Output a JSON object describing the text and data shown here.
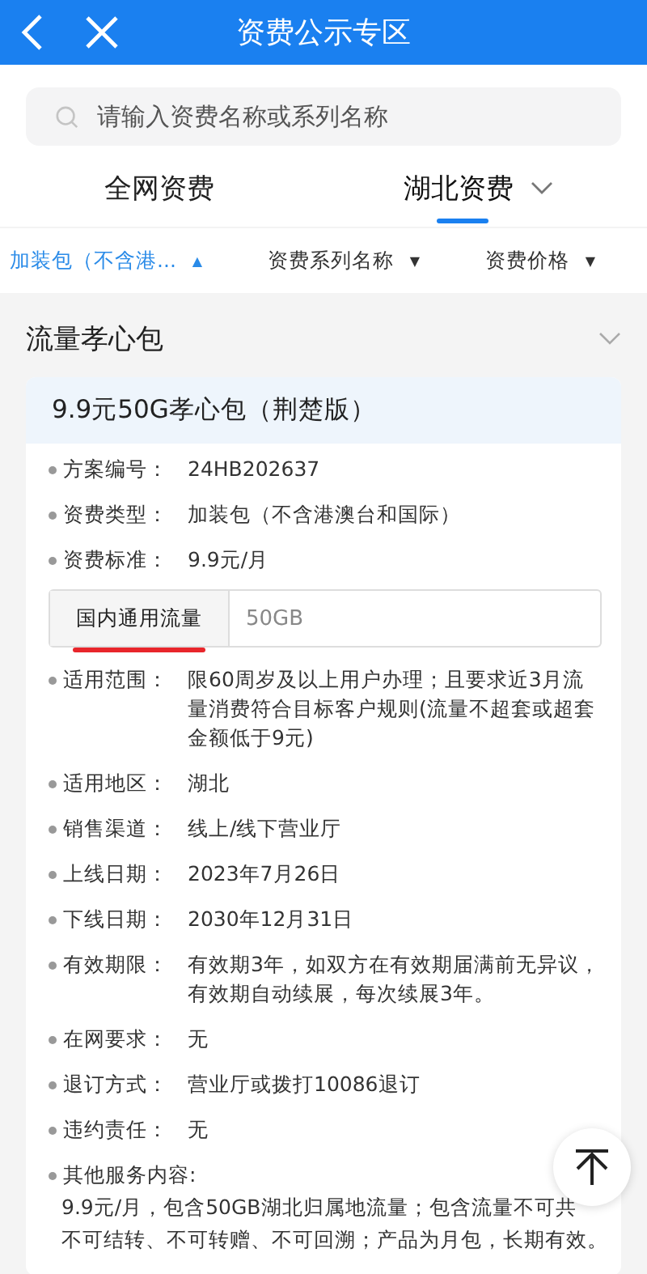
{
  "header": {
    "title": "资费公示专区"
  },
  "search": {
    "placeholder": "请输入资费名称或系列名称"
  },
  "tabs": [
    {
      "label": "全网资费",
      "selected": false,
      "dropdown": false
    },
    {
      "label": "湖北资费",
      "selected": true,
      "dropdown": true
    }
  ],
  "filters": [
    {
      "label": "加装包（不含港...",
      "selected": true,
      "icon": "▲"
    },
    {
      "label": "资费系列名称",
      "selected": false,
      "icon": "▼"
    },
    {
      "label": "资费价格",
      "selected": false,
      "icon": "▼"
    }
  ],
  "section": {
    "title": "流量孝心包",
    "expanded": true
  },
  "card": {
    "title": "9.9元50G孝心包（荆楚版）",
    "rows": [
      {
        "kind": "field",
        "label": "方案编号：",
        "value": "24HB202637"
      },
      {
        "kind": "field",
        "label": "资费类型：",
        "value": "加装包（不含港澳台和国际）"
      },
      {
        "kind": "field",
        "label": "资费标准：",
        "value": "9.9元/月"
      },
      {
        "kind": "spec",
        "label": "国内通用流量",
        "value": "50GB",
        "underlined": true
      },
      {
        "kind": "field",
        "label": "适用范围：",
        "value": "限60周岁及以上用户办理；且要求近3月流量消费符合目标客户规则(流量不超套或超套金额低于9元)"
      },
      {
        "kind": "field",
        "label": "适用地区：",
        "value": "湖北"
      },
      {
        "kind": "field",
        "label": "销售渠道：",
        "value": "线上/线下营业厅"
      },
      {
        "kind": "field",
        "label": "上线日期：",
        "value": "2023年7月26日"
      },
      {
        "kind": "field",
        "label": "下线日期：",
        "value": "2030年12月31日"
      },
      {
        "kind": "field",
        "label": "有效期限：",
        "value": "有效期3年，如双方在有效期届满前无异议，有效期自动续展，每次续展3年。"
      },
      {
        "kind": "field",
        "label": "在网要求：",
        "value": "无"
      },
      {
        "kind": "field",
        "label": "退订方式：",
        "value": "营业厅或拨打10086退订"
      },
      {
        "kind": "field",
        "label": "违约责任：",
        "value": "无"
      },
      {
        "kind": "block",
        "label": "其他服务内容:",
        "lines": [
          "9.9元/月，包含50GB湖北归属地流量；包含流量不可共",
          "不可结转、不可转赠、不可回溯；产品为月包，长期有效。"
        ]
      }
    ]
  }
}
